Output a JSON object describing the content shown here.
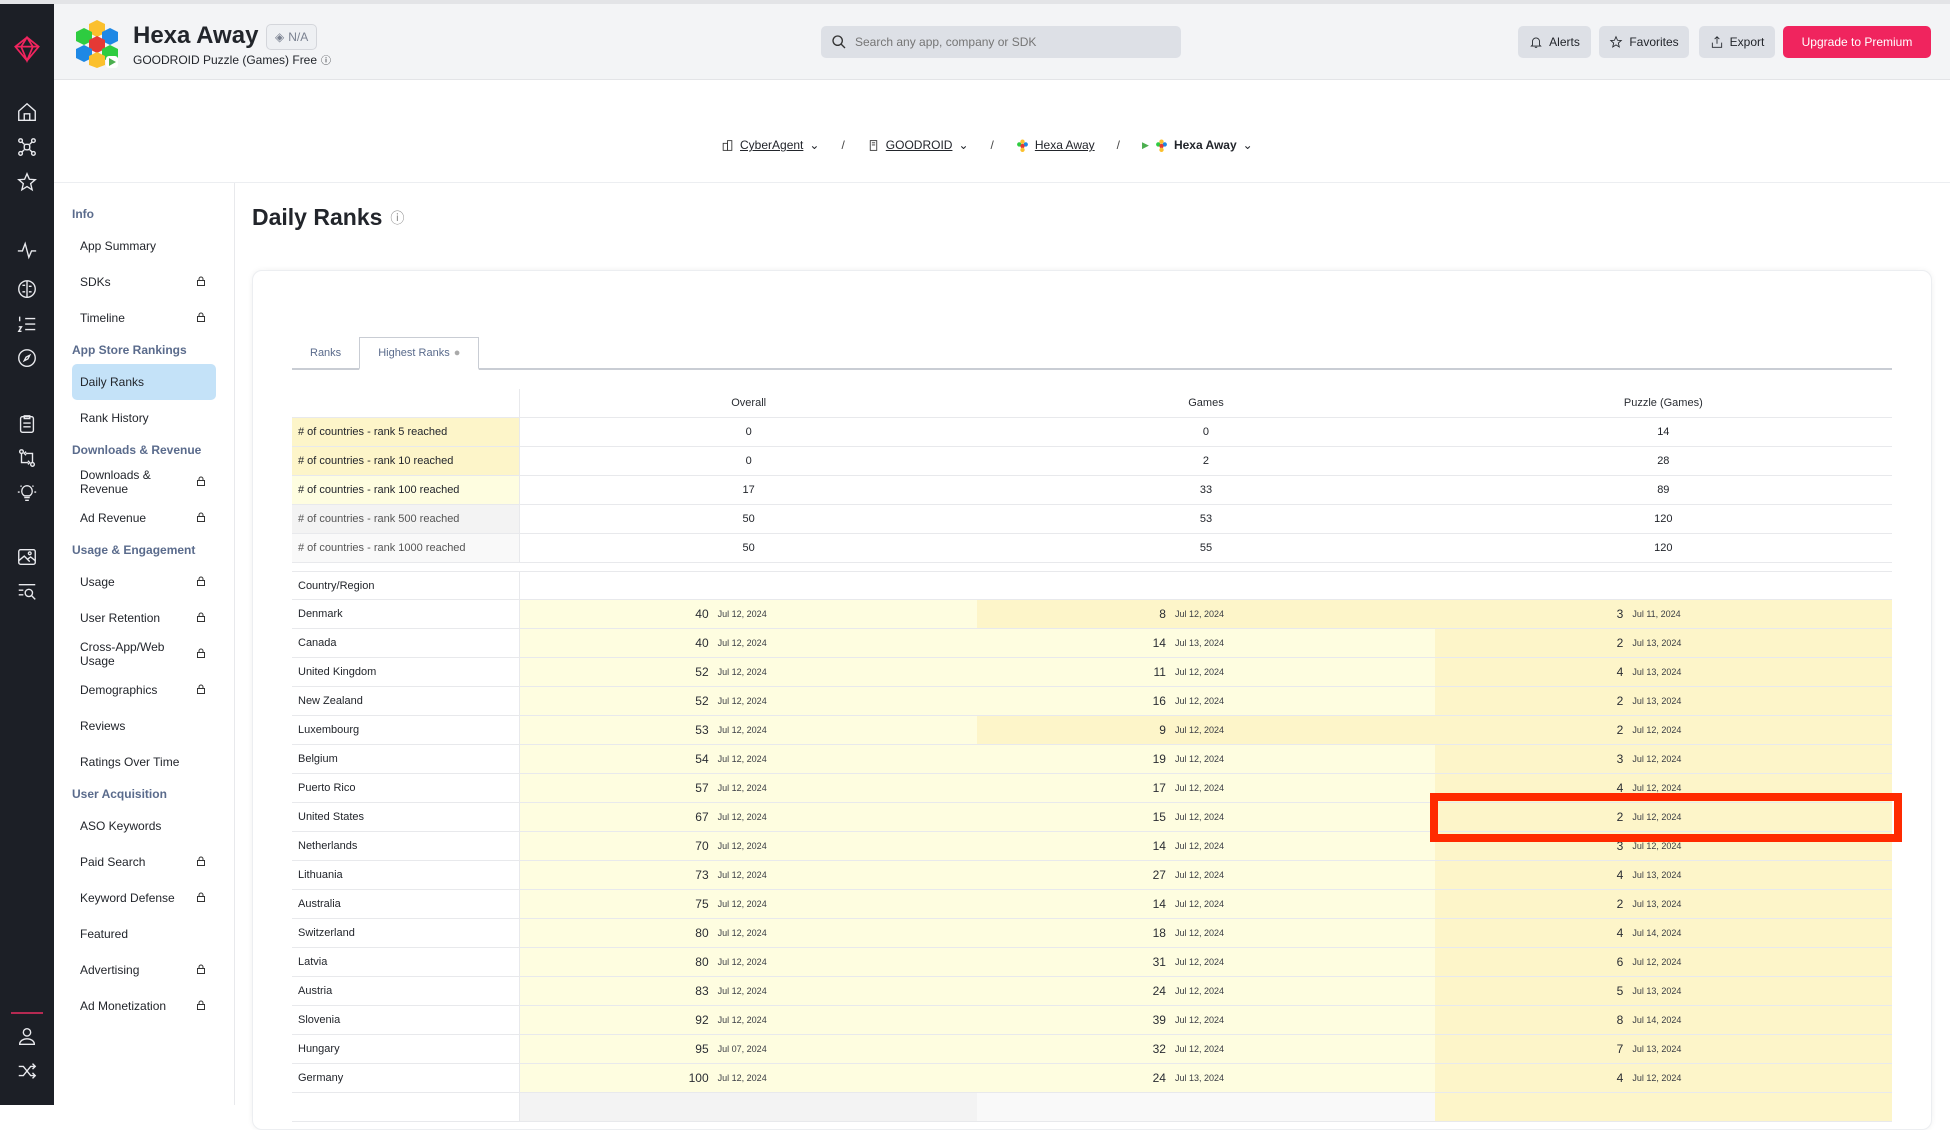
{
  "header": {
    "app_title": "Hexa Away",
    "badge": "N/A",
    "subtitle": "GOODROID Puzzle (Games) Free",
    "search_placeholder": "Search any app, company or SDK",
    "alerts": "Alerts",
    "favorites": "Favorites",
    "export": "Export",
    "upgrade": "Upgrade to Premium"
  },
  "breadcrumb": [
    "CyberAgent",
    "GOODROID",
    "Hexa Away",
    "Hexa Away"
  ],
  "sidebar": [
    {
      "type": "h",
      "label": "Info"
    },
    {
      "type": "i",
      "label": "App Summary",
      "locked": false
    },
    {
      "type": "i",
      "label": "SDKs",
      "locked": true
    },
    {
      "type": "i",
      "label": "Timeline",
      "locked": true
    },
    {
      "type": "h",
      "label": "App Store Rankings"
    },
    {
      "type": "i",
      "label": "Daily Ranks",
      "locked": false,
      "active": true
    },
    {
      "type": "i",
      "label": "Rank History",
      "locked": false
    },
    {
      "type": "h",
      "label": "Downloads & Revenue"
    },
    {
      "type": "i",
      "label": "Downloads & Revenue",
      "locked": true
    },
    {
      "type": "i",
      "label": "Ad Revenue",
      "locked": true
    },
    {
      "type": "h",
      "label": "Usage & Engagement"
    },
    {
      "type": "i",
      "label": "Usage",
      "locked": true
    },
    {
      "type": "i",
      "label": "User Retention",
      "locked": true
    },
    {
      "type": "i",
      "label": "Cross-App/Web Usage",
      "locked": true
    },
    {
      "type": "i",
      "label": "Demographics",
      "locked": true
    },
    {
      "type": "i",
      "label": "Reviews",
      "locked": false
    },
    {
      "type": "i",
      "label": "Ratings Over Time",
      "locked": false
    },
    {
      "type": "h",
      "label": "User Acquisition"
    },
    {
      "type": "i",
      "label": "ASO Keywords",
      "locked": false
    },
    {
      "type": "i",
      "label": "Paid Search",
      "locked": true
    },
    {
      "type": "i",
      "label": "Keyword Defense",
      "locked": true
    },
    {
      "type": "i",
      "label": "Featured",
      "locked": false
    },
    {
      "type": "i",
      "label": "Advertising",
      "locked": true
    },
    {
      "type": "i",
      "label": "Ad Monetization",
      "locked": true
    }
  ],
  "page": {
    "title": "Daily Ranks",
    "tabs": [
      "Ranks",
      "Highest Ranks"
    ],
    "active_tab": 1
  },
  "table": {
    "columns": [
      "Overall",
      "Games",
      "Puzzle (Games)"
    ],
    "summary": [
      {
        "label": "# of countries - rank 5 reached",
        "values": [
          "0",
          "0",
          "14"
        ]
      },
      {
        "label": "# of countries - rank 10 reached",
        "values": [
          "0",
          "2",
          "28"
        ]
      },
      {
        "label": "# of countries - rank 100 reached",
        "values": [
          "17",
          "33",
          "89"
        ]
      },
      {
        "label": "# of countries - rank 500 reached",
        "values": [
          "50",
          "53",
          "120"
        ]
      },
      {
        "label": "# of countries - rank 1000 reached",
        "values": [
          "50",
          "55",
          "120"
        ]
      }
    ],
    "country_header": "Country/Region",
    "rows": [
      [
        "Denmark",
        [
          "40",
          "Jul 12, 2024"
        ],
        [
          "8",
          "Jul 12, 2024"
        ],
        [
          "3",
          "Jul 11, 2024"
        ]
      ],
      [
        "Canada",
        [
          "40",
          "Jul 12, 2024"
        ],
        [
          "14",
          "Jul 13, 2024"
        ],
        [
          "2",
          "Jul 13, 2024"
        ]
      ],
      [
        "United Kingdom",
        [
          "52",
          "Jul 12, 2024"
        ],
        [
          "11",
          "Jul 12, 2024"
        ],
        [
          "4",
          "Jul 13, 2024"
        ]
      ],
      [
        "New Zealand",
        [
          "52",
          "Jul 12, 2024"
        ],
        [
          "16",
          "Jul 12, 2024"
        ],
        [
          "2",
          "Jul 13, 2024"
        ]
      ],
      [
        "Luxembourg",
        [
          "53",
          "Jul 12, 2024"
        ],
        [
          "9",
          "Jul 12, 2024"
        ],
        [
          "2",
          "Jul 12, 2024"
        ]
      ],
      [
        "Belgium",
        [
          "54",
          "Jul 12, 2024"
        ],
        [
          "19",
          "Jul 12, 2024"
        ],
        [
          "3",
          "Jul 12, 2024"
        ]
      ],
      [
        "Puerto Rico",
        [
          "57",
          "Jul 12, 2024"
        ],
        [
          "17",
          "Jul 12, 2024"
        ],
        [
          "4",
          "Jul 12, 2024"
        ]
      ],
      [
        "United States",
        [
          "67",
          "Jul 12, 2024"
        ],
        [
          "15",
          "Jul 12, 2024"
        ],
        [
          "2",
          "Jul 12, 2024"
        ]
      ],
      [
        "Netherlands",
        [
          "70",
          "Jul 12, 2024"
        ],
        [
          "14",
          "Jul 12, 2024"
        ],
        [
          "3",
          "Jul 12, 2024"
        ]
      ],
      [
        "Lithuania",
        [
          "73",
          "Jul 12, 2024"
        ],
        [
          "27",
          "Jul 12, 2024"
        ],
        [
          "4",
          "Jul 13, 2024"
        ]
      ],
      [
        "Australia",
        [
          "75",
          "Jul 12, 2024"
        ],
        [
          "14",
          "Jul 12, 2024"
        ],
        [
          "2",
          "Jul 13, 2024"
        ]
      ],
      [
        "Switzerland",
        [
          "80",
          "Jul 12, 2024"
        ],
        [
          "18",
          "Jul 12, 2024"
        ],
        [
          "4",
          "Jul 14, 2024"
        ]
      ],
      [
        "Latvia",
        [
          "80",
          "Jul 12, 2024"
        ],
        [
          "31",
          "Jul 12, 2024"
        ],
        [
          "6",
          "Jul 12, 2024"
        ]
      ],
      [
        "Austria",
        [
          "83",
          "Jul 12, 2024"
        ],
        [
          "24",
          "Jul 12, 2024"
        ],
        [
          "5",
          "Jul 13, 2024"
        ]
      ],
      [
        "Slovenia",
        [
          "92",
          "Jul 12, 2024"
        ],
        [
          "39",
          "Jul 12, 2024"
        ],
        [
          "8",
          "Jul 14, 2024"
        ]
      ],
      [
        "Hungary",
        [
          "95",
          "Jul 07, 2024"
        ],
        [
          "32",
          "Jul 12, 2024"
        ],
        [
          "7",
          "Jul 13, 2024"
        ]
      ],
      [
        "Germany",
        [
          "100",
          "Jul 12, 2024"
        ],
        [
          "24",
          "Jul 13, 2024"
        ],
        [
          "4",
          "Jul 12, 2024"
        ]
      ]
    ],
    "highlighted_row": "United States"
  },
  "colors": {
    "rail": "#1c1f26",
    "accent": "#f0245e",
    "active_nav": "#c4e2f8",
    "highlight_box": "#ff2a00",
    "cell_light": "#fefde0",
    "cell_dark": "#fdf5c9"
  }
}
